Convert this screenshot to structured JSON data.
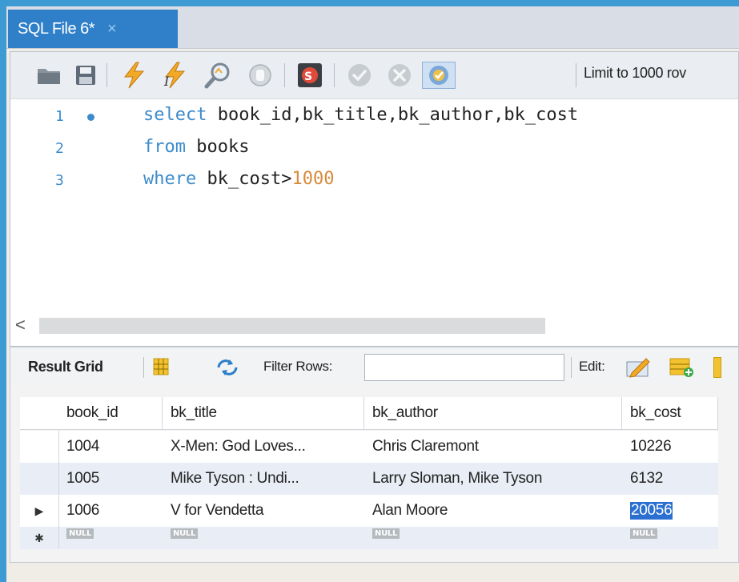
{
  "tab": {
    "title": "SQL File 6*",
    "close": "×"
  },
  "toolbar": {
    "icons": [
      "folder-open-icon",
      "save-icon",
      "execute-icon",
      "execute-current-icon",
      "explain-icon",
      "stop-icon",
      "toggle-error-icon",
      "commit-icon",
      "rollback-icon",
      "autocommit-icon"
    ],
    "limit_label": "Limit to 1000 rov"
  },
  "editor": {
    "lines": [
      {
        "num": "1",
        "has_marker": true
      },
      {
        "num": "2",
        "has_marker": false
      },
      {
        "num": "3",
        "has_marker": false
      }
    ],
    "tokens": {
      "l1_kw": "select",
      "l1_rest": " book_id,bk_title,bk_author,bk_cost",
      "l2_kw": "from",
      "l2_rest": " books",
      "l3_kw": "where",
      "l3_rest": " bk_cost>",
      "l3_num": "1000"
    },
    "scroll_left": "<"
  },
  "results": {
    "result_grid_label": "Result Grid",
    "filter_label": "Filter Rows:",
    "filter_value": "",
    "edit_label": "Edit:",
    "columns": [
      "book_id",
      "bk_title",
      "bk_author",
      "bk_cost"
    ],
    "rows": [
      [
        "1004",
        "X-Men: God Loves...",
        "Chris Claremont",
        "10226"
      ],
      [
        "1005",
        "Mike Tyson : Undi...",
        "Larry Sloman, Mike Tyson",
        "6132"
      ],
      [
        "1006",
        "V for Vendetta",
        "Alan Moore",
        "20056"
      ]
    ],
    "null_label": "NULL",
    "current_row_marker": "▶",
    "new_row_marker": "✱"
  },
  "colors": {
    "accent": "#2f7fc9",
    "keyword": "#3d8bcc",
    "number": "#d8893a",
    "frame": "#3d9ad3",
    "selection": "#2b6fd1"
  }
}
